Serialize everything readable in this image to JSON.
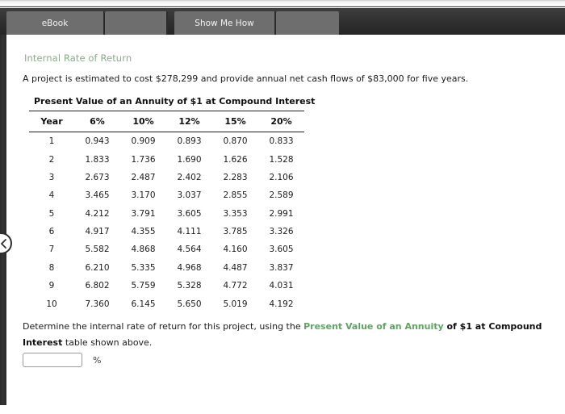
{
  "window": {
    "top_strip": "",
    "background_color": "#ffffff"
  },
  "tabbar": {
    "background_color": "#2f2f2f",
    "tab_color": "#6e6e6e",
    "tabs": [
      {
        "id": "ebook",
        "label": "eBook"
      },
      {
        "id": "blank1",
        "label": ""
      },
      {
        "id": "show",
        "label": "Show Me How"
      },
      {
        "id": "blank2",
        "label": ""
      }
    ]
  },
  "nav": {
    "prev_button_icon": "chevron-left-icon"
  },
  "main": {
    "section_title": "Internal Rate of Return",
    "section_title_color": "#8bab8b",
    "problem_text": "A project is estimated to cost $278,299 and provide annual net cash flows of $83,000 for five years.",
    "cost": "$278,299",
    "annual_cash_flow": "$83,000",
    "years": "five"
  },
  "table": {
    "caption": "Present Value of an Annuity of $1 at Compound Interest",
    "columns": [
      "Year",
      "6%",
      "10%",
      "12%",
      "15%",
      "20%"
    ],
    "rows": [
      [
        "1",
        "0.943",
        "0.909",
        "0.893",
        "0.870",
        "0.833"
      ],
      [
        "2",
        "1.833",
        "1.736",
        "1.690",
        "1.626",
        "1.528"
      ],
      [
        "3",
        "2.673",
        "2.487",
        "2.402",
        "2.283",
        "2.106"
      ],
      [
        "4",
        "3.465",
        "3.170",
        "3.037",
        "2.855",
        "2.589"
      ],
      [
        "5",
        "4.212",
        "3.791",
        "3.605",
        "3.353",
        "2.991"
      ],
      [
        "6",
        "4.917",
        "4.355",
        "4.111",
        "3.785",
        "3.326"
      ],
      [
        "7",
        "5.582",
        "4.868",
        "4.564",
        "4.160",
        "3.605"
      ],
      [
        "8",
        "6.210",
        "5.335",
        "4.968",
        "4.487",
        "3.837"
      ],
      [
        "9",
        "6.802",
        "5.759",
        "5.328",
        "4.772",
        "4.031"
      ],
      [
        "10",
        "7.360",
        "6.145",
        "5.650",
        "5.019",
        "4.192"
      ]
    ]
  },
  "prompt": {
    "lead": "Determine the internal rate of return for this project, using the ",
    "link_text": "Present Value of an Annuity",
    "link_color": "#5fa463",
    "bold_text": " of $1 at Compound Interest",
    "tail": " table shown above."
  },
  "answer": {
    "value": "",
    "placeholder": "",
    "unit": "%"
  }
}
